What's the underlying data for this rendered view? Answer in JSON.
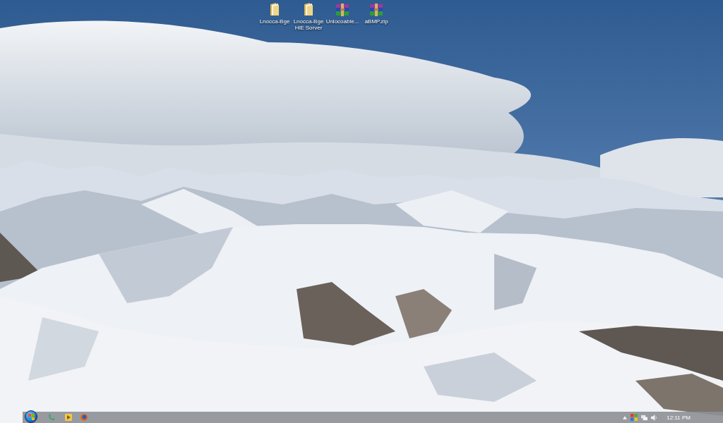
{
  "desktop_icons": [
    {
      "kind": "folder",
      "label": "Lnocca-Bge"
    },
    {
      "kind": "folder",
      "label": "Lnocca-Bge HiE Sorver"
    },
    {
      "kind": "archive",
      "label": "Unlocoable..."
    },
    {
      "kind": "archive",
      "label": "aBMP.zip"
    }
  ],
  "taskbar": {
    "clock": "12:11 PM"
  }
}
